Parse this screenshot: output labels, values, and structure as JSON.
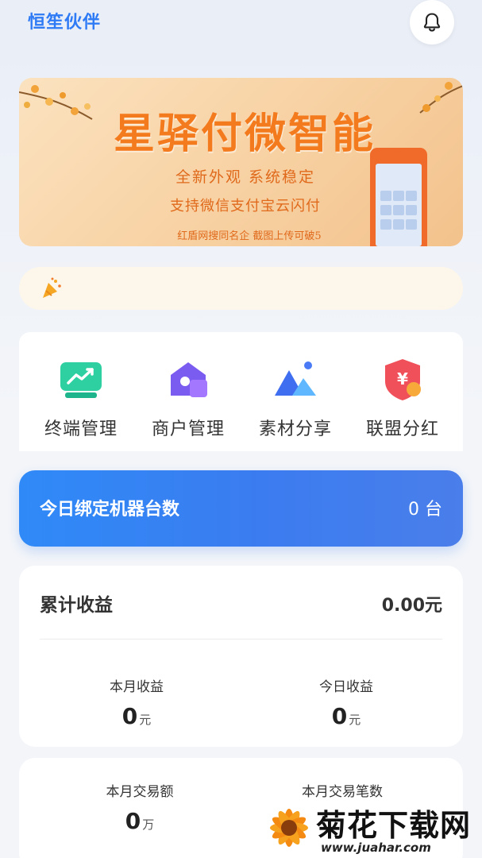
{
  "app": {
    "title": "恒笙伙伴"
  },
  "header": {
    "bell_icon": "bell-icon"
  },
  "banner": {
    "title": "星驿付微智能",
    "line1": "全新外观  系统稳定",
    "line2": "支持微信支付宝云闪付",
    "footer": "红盾网搜同名企 截图上传可破5",
    "colors": {
      "title": "#f47a1e",
      "text": "#e06a1c"
    }
  },
  "notice": {
    "icon": "party-popper-icon",
    "text": ""
  },
  "quick_menu": {
    "items": [
      {
        "label": "终端管理",
        "icon": "terminal-chart-icon"
      },
      {
        "label": "商户管理",
        "icon": "merchant-house-icon"
      },
      {
        "label": "素材分享",
        "icon": "mountain-image-icon"
      },
      {
        "label": "联盟分红",
        "icon": "yuan-shield-icon"
      }
    ]
  },
  "bind_card": {
    "label": "今日绑定机器台数",
    "value": "0 台",
    "accent": "#2f8af7"
  },
  "earnings": {
    "title": "累计收益",
    "total": "0.00元",
    "month": {
      "label": "本月收益",
      "value": "0",
      "unit": "元"
    },
    "today": {
      "label": "今日收益",
      "value": "0",
      "unit": "元"
    }
  },
  "trade": {
    "volume": {
      "label": "本月交易额",
      "value": "0",
      "unit": "万"
    },
    "count": {
      "label": "本月交易笔数"
    }
  },
  "watermark": {
    "name": "菊花下载网",
    "url": "www.juahar.com"
  }
}
